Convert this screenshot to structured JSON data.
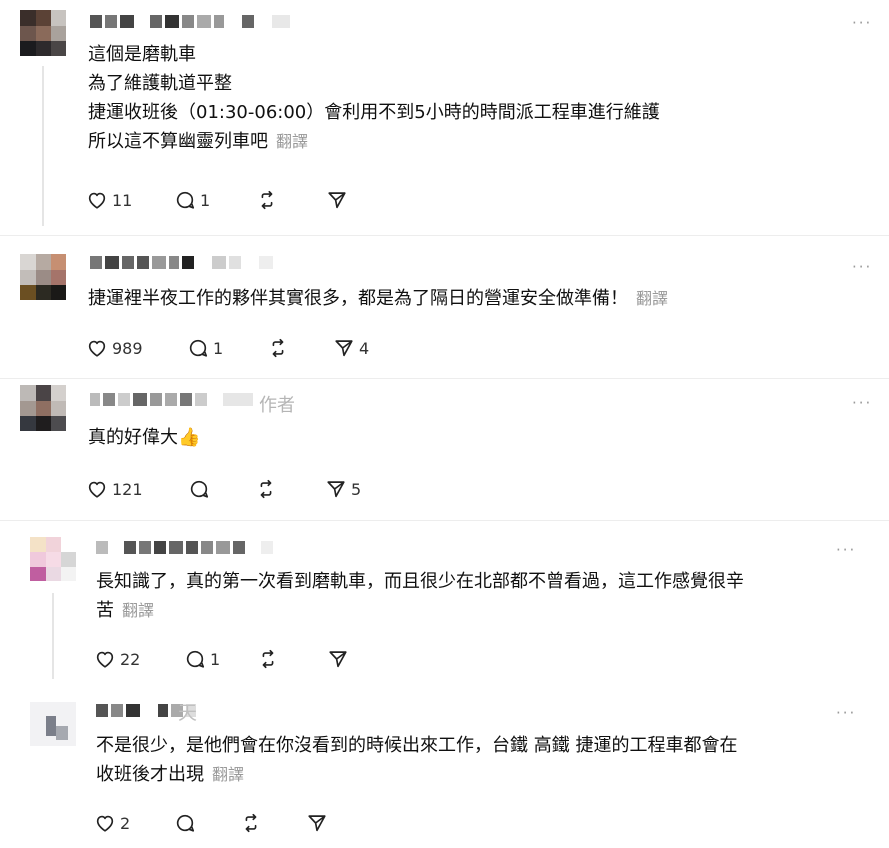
{
  "comments": [
    {
      "text_lines": [
        "這個是磨軌車",
        "為了維護軌道平整",
        "捷運收班後（01:30-06:00）會利用不到5小時的時間派工程車進行維護",
        "所以這不算幽靈列車吧"
      ],
      "translate": "翻譯",
      "likes": "11",
      "replies": "1",
      "shares": ""
    },
    {
      "text_lines": [
        "捷運裡半夜工作的夥伴其實很多，都是為了隔日的營運安全做準備！"
      ],
      "translate": "翻譯",
      "likes": "989",
      "replies": "1",
      "shares": "4"
    },
    {
      "author_tag": "作者",
      "text_lines": [
        "真的好偉大👍"
      ],
      "translate": "",
      "likes": "121",
      "replies": "",
      "shares": "5"
    },
    {
      "text_lines": [
        "長知識了，真的第一次看到磨軌車，而且很少在北部都不曾看過，這工作感覺很辛",
        "苦"
      ],
      "translate": "翻譯",
      "likes": "22",
      "replies": "1",
      "shares": ""
    },
    {
      "name_fragment": "天",
      "text_lines": [
        "不是很少，是他們會在你沒看到的時候出來工作，台鐵 高鐵 捷運的工程車都會在",
        "收班後才出現"
      ],
      "translate": "翻譯",
      "likes": "2",
      "replies": "",
      "shares": ""
    }
  ],
  "more_label": "···",
  "icons": {
    "like": "heart-icon",
    "reply": "comment-icon",
    "repost": "repost-icon",
    "share": "send-icon"
  }
}
